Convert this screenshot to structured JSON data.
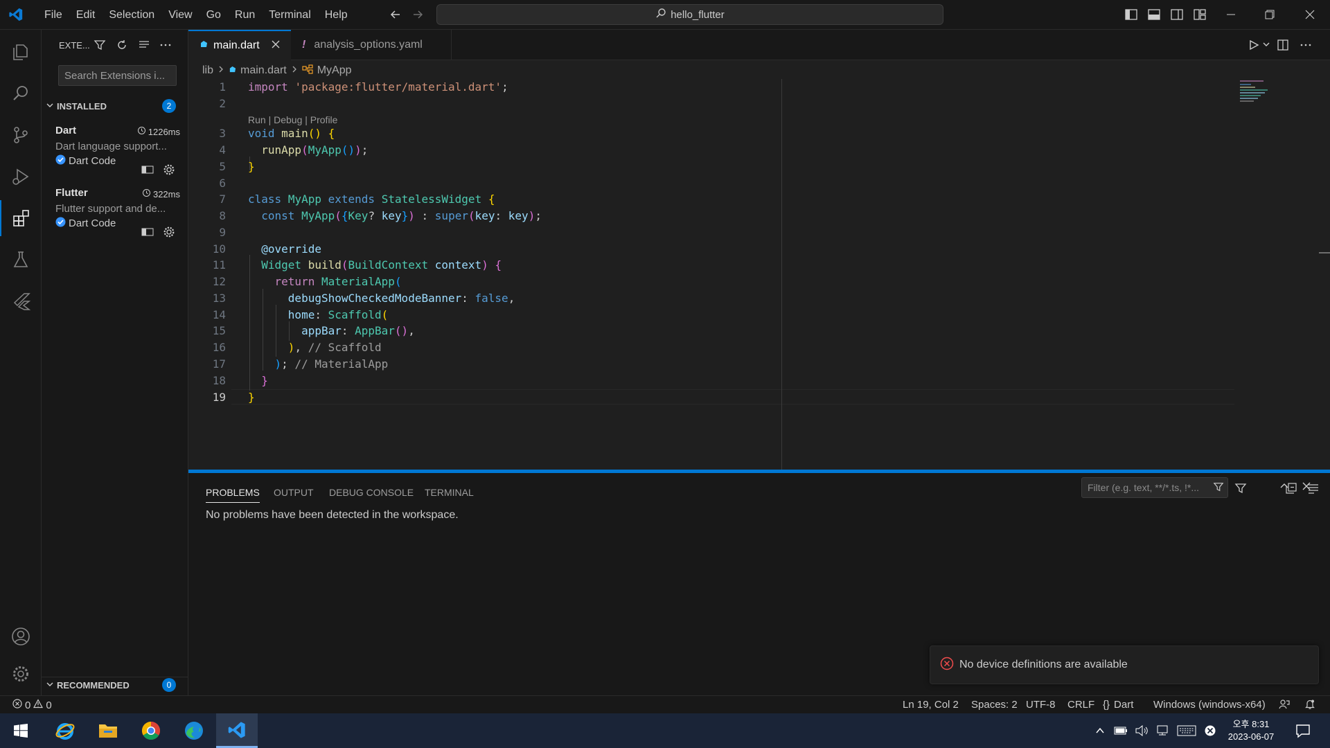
{
  "titlebar": {
    "menu": [
      "File",
      "Edit",
      "Selection",
      "View",
      "Go",
      "Run",
      "Terminal",
      "Help"
    ],
    "search_text": "hello_flutter"
  },
  "sidebar": {
    "title": "EXTE...",
    "search_placeholder": "Search Extensions i...",
    "installed_label": "INSTALLED",
    "installed_count": "2",
    "recommended_label": "RECOMMENDED",
    "recommended_count": "0",
    "extensions": [
      {
        "name": "Dart",
        "time": "1226ms",
        "description": "Dart language support...",
        "publisher": "Dart Code"
      },
      {
        "name": "Flutter",
        "time": "322ms",
        "description": "Flutter support and de...",
        "publisher": "Dart Code"
      }
    ]
  },
  "tabs": [
    {
      "label": "main.dart",
      "active": true
    },
    {
      "label": "analysis_options.yaml",
      "active": false
    }
  ],
  "breadcrumb": [
    "lib",
    "main.dart",
    "MyApp"
  ],
  "editor": {
    "codelens": "Run | Debug | Profile",
    "line_numbers": [
      "1",
      "2",
      "3",
      "4",
      "5",
      "6",
      "7",
      "8",
      "9",
      "10",
      "11",
      "12",
      "13",
      "14",
      "15",
      "16",
      "17",
      "18",
      "19"
    ],
    "current_line": "19"
  },
  "panel": {
    "tabs": [
      "PROBLEMS",
      "OUTPUT",
      "DEBUG CONSOLE",
      "TERMINAL"
    ],
    "filter_placeholder": "Filter (e.g. text, **/*.ts, !*...",
    "message": "No problems have been detected in the workspace."
  },
  "notification": {
    "message": "No device definitions are available"
  },
  "statusbar": {
    "errors": "0",
    "warnings": "0",
    "position": "Ln 19, Col 2",
    "spaces": "Spaces: 2",
    "encoding": "UTF-8",
    "eol": "CRLF",
    "language": "Dart",
    "platform": "Windows (windows-x64)"
  },
  "taskbar": {
    "time": "오후 8:31",
    "date": "2023-06-07"
  },
  "colors": {
    "accent": "#0078d4",
    "background": "#1f1f1f",
    "sidebar": "#181818",
    "taskbar": "#1a2437"
  }
}
